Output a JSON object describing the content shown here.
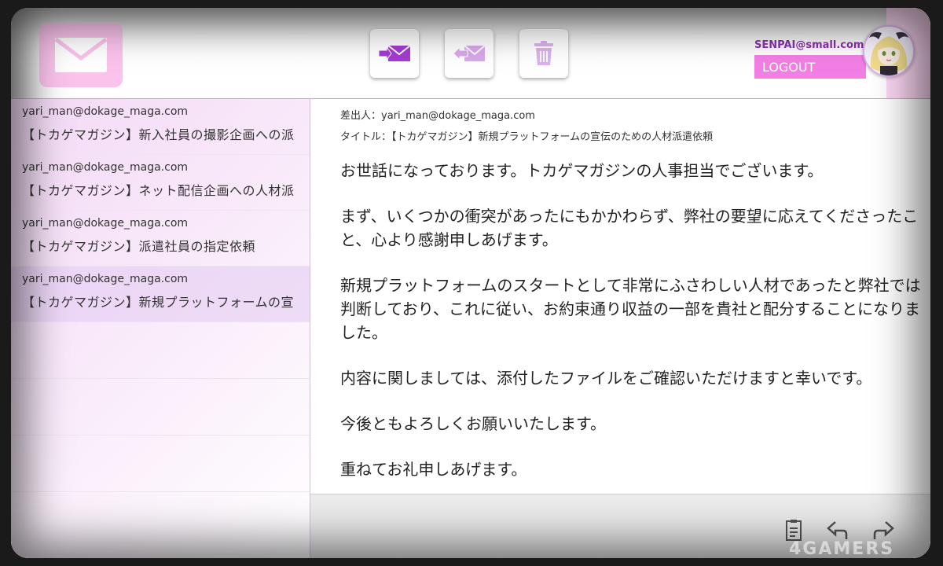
{
  "header": {
    "app_icon": "mail-envelope-icon",
    "toolbar": [
      {
        "name": "compose-button",
        "icon": "send-mail-icon"
      },
      {
        "name": "reply-button",
        "icon": "reply-mail-icon"
      },
      {
        "name": "delete-button",
        "icon": "trash-icon"
      }
    ],
    "account_email": "SENPAI@small.com",
    "logout_label": "LOGOUT",
    "colors": {
      "accent": "#f27fe6",
      "icon_purple": "#a53bd2",
      "logo_bg": "#fbc3ec"
    }
  },
  "inbox": {
    "items": [
      {
        "from": "yari_man@dokage_maga.com",
        "subject": "【トカゲマガジン】新入社員の撮影企画への派",
        "selected": false
      },
      {
        "from": "yari_man@dokage_maga.com",
        "subject": "【トカゲマガジン】ネット配信企画への人材派",
        "selected": false
      },
      {
        "from": "yari_man@dokage_maga.com",
        "subject": "【トカゲマガジン】派遣社員の指定依頼",
        "selected": false
      },
      {
        "from": "yari_man@dokage_maga.com",
        "subject": "【トカゲマガジン】新規プラットフォームの宣",
        "selected": true
      }
    ]
  },
  "message": {
    "sender_line": "差出人：yari_man@dokage_maga.com",
    "title_line": "タイトル：【トカゲマガジン】新規プラットフォームの宣伝のための人材派遣依頼",
    "paragraphs": [
      " お世話になっております。トカゲマガジンの人事担当でございます。",
      " まず、いくつかの衝突があったにもかかわらず、弊社の要望に応えてくださったこと、心より感謝申しあげます。",
      " 新規プラットフォームのスタートとして非常にふさわしい人材であったと弊社では判断しており、これに従い、お約束通り収益の一部を貴社と配分することになりました。",
      " 内容に関しましては、添付したファイルをご確認いただけますと幸いです。",
      " 今後ともよろしくお願いいたします。",
      " 重ねてお礼申しあげます。"
    ]
  },
  "footer": {
    "icons": [
      "document-icon",
      "reply-arrow-icon",
      "forward-arrow-icon"
    ]
  },
  "watermark": "4GAMERS"
}
